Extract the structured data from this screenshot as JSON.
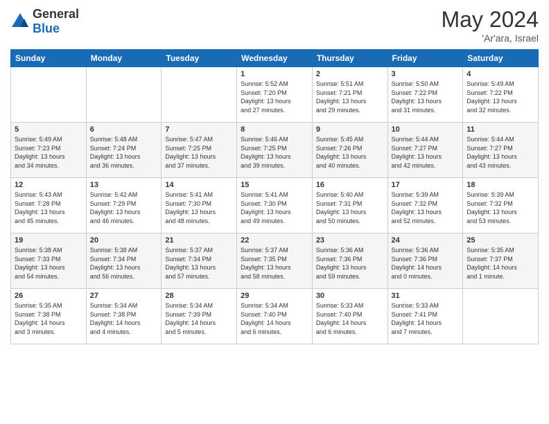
{
  "header": {
    "logo_general": "General",
    "logo_blue": "Blue",
    "month_year": "May 2024",
    "location": "'Ar'ara, Israel"
  },
  "weekdays": [
    "Sunday",
    "Monday",
    "Tuesday",
    "Wednesday",
    "Thursday",
    "Friday",
    "Saturday"
  ],
  "weeks": [
    [
      {
        "day": "",
        "info": ""
      },
      {
        "day": "",
        "info": ""
      },
      {
        "day": "",
        "info": ""
      },
      {
        "day": "1",
        "info": "Sunrise: 5:52 AM\nSunset: 7:20 PM\nDaylight: 13 hours\nand 27 minutes."
      },
      {
        "day": "2",
        "info": "Sunrise: 5:51 AM\nSunset: 7:21 PM\nDaylight: 13 hours\nand 29 minutes."
      },
      {
        "day": "3",
        "info": "Sunrise: 5:50 AM\nSunset: 7:22 PM\nDaylight: 13 hours\nand 31 minutes."
      },
      {
        "day": "4",
        "info": "Sunrise: 5:49 AM\nSunset: 7:22 PM\nDaylight: 13 hours\nand 32 minutes."
      }
    ],
    [
      {
        "day": "5",
        "info": "Sunrise: 5:49 AM\nSunset: 7:23 PM\nDaylight: 13 hours\nand 34 minutes."
      },
      {
        "day": "6",
        "info": "Sunrise: 5:48 AM\nSunset: 7:24 PM\nDaylight: 13 hours\nand 36 minutes."
      },
      {
        "day": "7",
        "info": "Sunrise: 5:47 AM\nSunset: 7:25 PM\nDaylight: 13 hours\nand 37 minutes."
      },
      {
        "day": "8",
        "info": "Sunrise: 5:46 AM\nSunset: 7:25 PM\nDaylight: 13 hours\nand 39 minutes."
      },
      {
        "day": "9",
        "info": "Sunrise: 5:45 AM\nSunset: 7:26 PM\nDaylight: 13 hours\nand 40 minutes."
      },
      {
        "day": "10",
        "info": "Sunrise: 5:44 AM\nSunset: 7:27 PM\nDaylight: 13 hours\nand 42 minutes."
      },
      {
        "day": "11",
        "info": "Sunrise: 5:44 AM\nSunset: 7:27 PM\nDaylight: 13 hours\nand 43 minutes."
      }
    ],
    [
      {
        "day": "12",
        "info": "Sunrise: 5:43 AM\nSunset: 7:28 PM\nDaylight: 13 hours\nand 45 minutes."
      },
      {
        "day": "13",
        "info": "Sunrise: 5:42 AM\nSunset: 7:29 PM\nDaylight: 13 hours\nand 46 minutes."
      },
      {
        "day": "14",
        "info": "Sunrise: 5:41 AM\nSunset: 7:30 PM\nDaylight: 13 hours\nand 48 minutes."
      },
      {
        "day": "15",
        "info": "Sunrise: 5:41 AM\nSunset: 7:30 PM\nDaylight: 13 hours\nand 49 minutes."
      },
      {
        "day": "16",
        "info": "Sunrise: 5:40 AM\nSunset: 7:31 PM\nDaylight: 13 hours\nand 50 minutes."
      },
      {
        "day": "17",
        "info": "Sunrise: 5:39 AM\nSunset: 7:32 PM\nDaylight: 13 hours\nand 52 minutes."
      },
      {
        "day": "18",
        "info": "Sunrise: 5:39 AM\nSunset: 7:32 PM\nDaylight: 13 hours\nand 53 minutes."
      }
    ],
    [
      {
        "day": "19",
        "info": "Sunrise: 5:38 AM\nSunset: 7:33 PM\nDaylight: 13 hours\nand 54 minutes."
      },
      {
        "day": "20",
        "info": "Sunrise: 5:38 AM\nSunset: 7:34 PM\nDaylight: 13 hours\nand 56 minutes."
      },
      {
        "day": "21",
        "info": "Sunrise: 5:37 AM\nSunset: 7:34 PM\nDaylight: 13 hours\nand 57 minutes."
      },
      {
        "day": "22",
        "info": "Sunrise: 5:37 AM\nSunset: 7:35 PM\nDaylight: 13 hours\nand 58 minutes."
      },
      {
        "day": "23",
        "info": "Sunrise: 5:36 AM\nSunset: 7:36 PM\nDaylight: 13 hours\nand 59 minutes."
      },
      {
        "day": "24",
        "info": "Sunrise: 5:36 AM\nSunset: 7:36 PM\nDaylight: 14 hours\nand 0 minutes."
      },
      {
        "day": "25",
        "info": "Sunrise: 5:35 AM\nSunset: 7:37 PM\nDaylight: 14 hours\nand 1 minute."
      }
    ],
    [
      {
        "day": "26",
        "info": "Sunrise: 5:35 AM\nSunset: 7:38 PM\nDaylight: 14 hours\nand 3 minutes."
      },
      {
        "day": "27",
        "info": "Sunrise: 5:34 AM\nSunset: 7:38 PM\nDaylight: 14 hours\nand 4 minutes."
      },
      {
        "day": "28",
        "info": "Sunrise: 5:34 AM\nSunset: 7:39 PM\nDaylight: 14 hours\nand 5 minutes."
      },
      {
        "day": "29",
        "info": "Sunrise: 5:34 AM\nSunset: 7:40 PM\nDaylight: 14 hours\nand 6 minutes."
      },
      {
        "day": "30",
        "info": "Sunrise: 5:33 AM\nSunset: 7:40 PM\nDaylight: 14 hours\nand 6 minutes."
      },
      {
        "day": "31",
        "info": "Sunrise: 5:33 AM\nSunset: 7:41 PM\nDaylight: 14 hours\nand 7 minutes."
      },
      {
        "day": "",
        "info": ""
      }
    ]
  ]
}
